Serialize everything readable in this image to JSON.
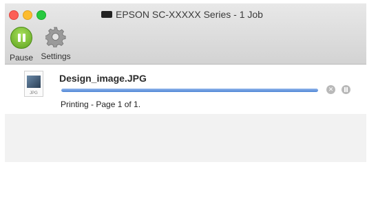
{
  "window": {
    "title": "EPSON SC-XXXXX Series - 1 Job",
    "title_icon": "printer-icon"
  },
  "toolbar": {
    "pause_label": "Pause",
    "settings_label": "Settings"
  },
  "job": {
    "file_name": "Design_image.JPG",
    "file_ext_label": "JPG",
    "status": "Printing - Page 1 of 1.",
    "progress_percent": 100
  },
  "colors": {
    "pause_green": "#6bb22a",
    "progress_blue": "#4f86d6"
  }
}
